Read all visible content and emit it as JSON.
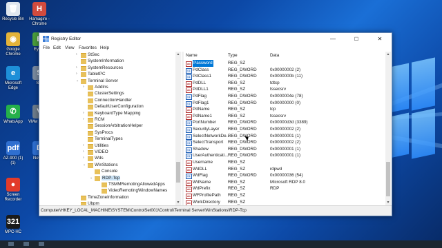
{
  "desktop_icons": [
    {
      "name": "recycle-bin-icon",
      "label": "Recycle Bin",
      "glyph": "🗑",
      "color": "#dfe6ee"
    },
    {
      "name": "hamagire-chrome-icon",
      "label": "Hamagire - Chrome",
      "glyph": "H",
      "color": "#d24b3e"
    },
    {
      "name": "google-chrome-icon",
      "label": "Google Chrome",
      "glyph": "◉",
      "color": "#e3b33a"
    },
    {
      "name": "eye-s-icon",
      "label": "Eye S",
      "glyph": "E",
      "color": "#4a9e3c"
    },
    {
      "name": "microsoft-edge-icon",
      "label": "Microsoft Edge",
      "glyph": "e",
      "color": "#1e8fd8"
    },
    {
      "name": "ser-icon",
      "label": "Ser",
      "glyph": "S",
      "color": "#7a8aa0"
    },
    {
      "name": "whatsapp-icon",
      "label": "WhatsApp",
      "glyph": "✆",
      "color": "#25b04a"
    },
    {
      "name": "vmware-icon",
      "label": "VMw Works",
      "glyph": "V",
      "color": "#6e7d8c"
    },
    {
      "name": "az-900-pdf-icon",
      "label": "AZ-900 (1) (1)",
      "glyph": "pdf",
      "color": "#2f6fd0"
    },
    {
      "name": "new-doc-icon",
      "label": "New D",
      "glyph": "D",
      "color": "#2f6fd0"
    },
    {
      "name": "screen-recorder-icon",
      "label": "Screen Recorder",
      "glyph": "●",
      "color": "#e23b2a"
    },
    {
      "name": "mpc-hc-icon",
      "label": "MPC-HC",
      "glyph": "321",
      "color": "#1b1b1b"
    }
  ],
  "window": {
    "title": "Registry Editor",
    "controls": {
      "minimize": "—",
      "maximize": "☐",
      "close": "✕"
    },
    "menu": [
      "File",
      "Edit",
      "View",
      "Favorites",
      "Help"
    ],
    "status_path": "Computer\\HKEY_LOCAL_MACHINE\\SYSTEM\\ControlSet001\\Control\\Terminal Server\\WinStations\\RDP-Tcp"
  },
  "tree": [
    {
      "label": "StSec",
      "level": 0,
      "exp": "›"
    },
    {
      "label": "SystemInformation",
      "level": 0,
      "exp": ""
    },
    {
      "label": "SystemResources",
      "level": 0,
      "exp": "›"
    },
    {
      "label": "TabletPC",
      "level": 0,
      "exp": "›"
    },
    {
      "label": "Terminal Server",
      "level": 0,
      "exp": "⌄"
    },
    {
      "label": "AddIns",
      "level": 1,
      "exp": "›"
    },
    {
      "label": "ClusterSettings",
      "level": 1,
      "exp": ""
    },
    {
      "label": "ConnectionHandler",
      "level": 1,
      "exp": ""
    },
    {
      "label": "DefaultUserConfiguration",
      "level": 1,
      "exp": ""
    },
    {
      "label": "KeyboardType Mapping",
      "level": 1,
      "exp": "›"
    },
    {
      "label": "RCM",
      "level": 1,
      "exp": "›"
    },
    {
      "label": "SessionArbitrationHelper",
      "level": 1,
      "exp": ""
    },
    {
      "label": "SysProcs",
      "level": 1,
      "exp": ""
    },
    {
      "label": "TerminalTypes",
      "level": 1,
      "exp": ""
    },
    {
      "label": "Utilities",
      "level": 1,
      "exp": "›"
    },
    {
      "label": "VIDEO",
      "level": 1,
      "exp": "›"
    },
    {
      "label": "Wds",
      "level": 1,
      "exp": "›"
    },
    {
      "label": "WinStations",
      "level": 1,
      "exp": "⌄"
    },
    {
      "label": "Console",
      "level": 2,
      "exp": ""
    },
    {
      "label": "RDP-Tcp",
      "level": 2,
      "exp": "⌄",
      "selected": true
    },
    {
      "label": "TSMMRemotingAllowedApps",
      "level": 3,
      "exp": ""
    },
    {
      "label": "VideoRemotingWindowNames",
      "level": 3,
      "exp": ""
    },
    {
      "label": "TimeZoneInformation",
      "level": 0,
      "exp": ""
    },
    {
      "label": "Ubpm",
      "level": 0,
      "exp": ""
    }
  ],
  "list_headers": {
    "name": "Name",
    "type": "Type",
    "data": "Data"
  },
  "values": [
    {
      "name": "Password",
      "type": "REG_SZ",
      "data": "",
      "kind": "ab",
      "selected": true
    },
    {
      "name": "PdClass",
      "type": "REG_DWORD",
      "data": "0x00000002 (2)",
      "kind": "bin"
    },
    {
      "name": "PdClass1",
      "type": "REG_DWORD",
      "data": "0x0000000b (11)",
      "kind": "bin"
    },
    {
      "name": "PdDLL",
      "type": "REG_SZ",
      "data": "tdtcp",
      "kind": "ab"
    },
    {
      "name": "PdDLL1",
      "type": "REG_SZ",
      "data": "tssecsrv",
      "kind": "ab"
    },
    {
      "name": "PdFlag",
      "type": "REG_DWORD",
      "data": "0x0000004e (78)",
      "kind": "bin"
    },
    {
      "name": "PdFlag1",
      "type": "REG_DWORD",
      "data": "0x00000000 (0)",
      "kind": "bin"
    },
    {
      "name": "PdName",
      "type": "REG_SZ",
      "data": "tcp",
      "kind": "ab"
    },
    {
      "name": "PdName1",
      "type": "REG_SZ",
      "data": "tssecsrv",
      "kind": "ab"
    },
    {
      "name": "PortNumber",
      "type": "REG_DWORD",
      "data": "0x00000d3d (3389)",
      "kind": "bin"
    },
    {
      "name": "SecurityLayer",
      "type": "REG_DWORD",
      "data": "0x00000002 (2)",
      "kind": "bin"
    },
    {
      "name": "SelectNetworkDe...",
      "type": "REG_DWORD",
      "data": "0x00000001 (1)",
      "kind": "bin"
    },
    {
      "name": "SelectTransport",
      "type": "REG_DWORD",
      "data": "0x00000002 (2)",
      "kind": "bin"
    },
    {
      "name": "Shadow",
      "type": "REG_DWORD",
      "data": "0x00000001 (1)",
      "kind": "bin"
    },
    {
      "name": "UserAuthenticati...",
      "type": "REG_DWORD",
      "data": "0x00000001 (1)",
      "kind": "bin"
    },
    {
      "name": "Username",
      "type": "REG_SZ",
      "data": "",
      "kind": "ab"
    },
    {
      "name": "WdDLL",
      "type": "REG_SZ",
      "data": "rdpwd",
      "kind": "ab"
    },
    {
      "name": "WdFlag",
      "type": "REG_DWORD",
      "data": "0x00000036 (54)",
      "kind": "bin"
    },
    {
      "name": "WdName",
      "type": "REG_SZ",
      "data": "Microsoft RDP 8.0",
      "kind": "ab"
    },
    {
      "name": "WdPrefix",
      "type": "REG_SZ",
      "data": "RDP",
      "kind": "ab"
    },
    {
      "name": "WFProfilePath",
      "type": "REG_SZ",
      "data": "",
      "kind": "ab"
    },
    {
      "name": "WorkDirectory",
      "type": "REG_SZ",
      "data": "",
      "kind": "ab"
    }
  ],
  "icon_glyphs": {
    "ab": "ab",
    "bin": "01"
  }
}
